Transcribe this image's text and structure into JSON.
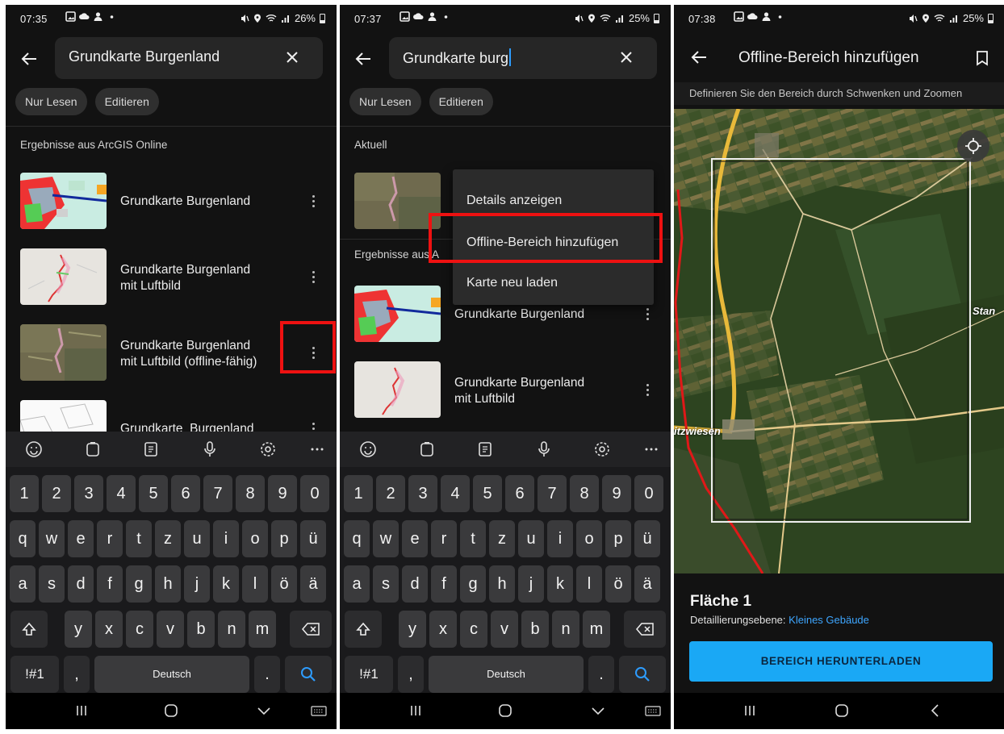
{
  "phones": [
    {
      "status": {
        "time": "07:35",
        "battery": "26%"
      },
      "search": {
        "query": "Grundkarte Burgenland"
      },
      "chips": [
        "Nur Lesen",
        "Editieren"
      ],
      "section_label": "Ergebnisse aus ArcGIS Online",
      "items": [
        {
          "line1": "Grundkarte Burgenland",
          "line2": ""
        },
        {
          "line1": "Grundkarte Burgenland",
          "line2": "mit Luftbild"
        },
        {
          "line1": "Grundkarte Burgenland",
          "line2": "mit Luftbild (offline-fähig)"
        },
        {
          "line1": "Grundkarte_Burgenland",
          "line2": ""
        }
      ]
    },
    {
      "status": {
        "time": "07:37",
        "battery": "25%"
      },
      "search": {
        "query": "Grundkarte burg"
      },
      "chips": [
        "Nur Lesen",
        "Editieren"
      ],
      "current_label": "Aktuell",
      "section_label": "Ergebnisse aus A",
      "items": [
        {
          "line1": "Grundkarte Burgenland",
          "line2": ""
        },
        {
          "line1": "Grundkarte Burgenland",
          "line2": "mit Luftbild"
        }
      ],
      "menu": [
        "Details anzeigen",
        "Offline-Bereich hinzufügen",
        "Karte neu laden"
      ]
    },
    {
      "status": {
        "time": "07:38",
        "battery": "25%"
      },
      "title": "Offline-Bereich hinzufügen",
      "subtitle": "Definieren Sie den Bereich durch Schwenken und Zoomen",
      "map_labels": {
        "left": "itzwiesen",
        "right": "Stan"
      },
      "area_name": "Fläche 1",
      "detail_label": "Detaillierungsebene:",
      "detail_value": "Kleines Gebäude",
      "download_button": "BEREICH HERUNTERLADEN"
    }
  ],
  "keyboard": {
    "numbers": [
      "1",
      "2",
      "3",
      "4",
      "5",
      "6",
      "7",
      "8",
      "9",
      "0"
    ],
    "row1": [
      "q",
      "w",
      "e",
      "r",
      "t",
      "z",
      "u",
      "i",
      "o",
      "p",
      "ü"
    ],
    "row2": [
      "a",
      "s",
      "d",
      "f",
      "g",
      "h",
      "j",
      "k",
      "l",
      "ö",
      "ä"
    ],
    "row3": [
      "y",
      "x",
      "c",
      "v",
      "b",
      "n",
      "m"
    ],
    "symbols_key": "!#1",
    "comma_key": ",",
    "space_label": "Deutsch",
    "period_key": "."
  },
  "colors": {
    "accent": "#1aa8f5",
    "highlight": "#ee1111",
    "link": "#3ea6ff",
    "background": "#121212"
  }
}
